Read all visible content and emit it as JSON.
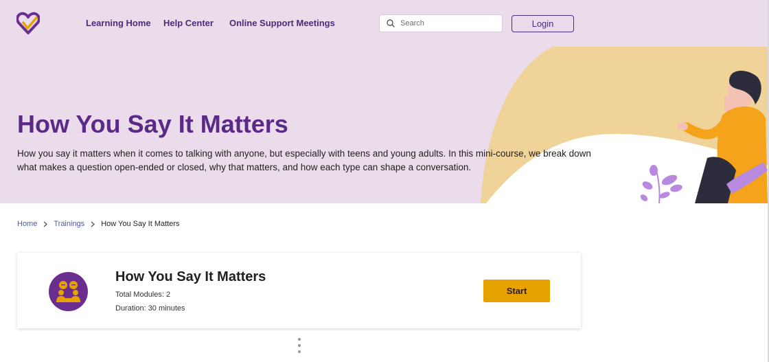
{
  "nav": {
    "links": [
      "Learning Home",
      "Help Center",
      "Online Support Meetings"
    ],
    "search_placeholder": "Search",
    "login_label": "Login"
  },
  "hero": {
    "title": "How You Say It Matters",
    "description": "How you say it matters when it comes to talking with anyone, but especially with teens and young adults. In this mini-course, we break down what makes a question open-ended or closed, why that matters, and how each type can shape a conversation."
  },
  "breadcrumb": {
    "home": "Home",
    "trainings": "Trainings",
    "current": "How You Say It Matters"
  },
  "course": {
    "title": "How You Say It Matters",
    "modules": "Total Modules: 2",
    "duration": "Duration: 30 minutes",
    "start_label": "Start"
  },
  "colors": {
    "hero_bg": "#eadcea",
    "accent_purple": "#5b2a86",
    "accent_yellow": "#e8a200",
    "nav_text": "#4a2a7a"
  },
  "icons": [
    "brand-logo-icon",
    "search-icon",
    "chevron-right-icon",
    "course-conversation-icon",
    "person-illustration",
    "leaf-icon"
  ]
}
